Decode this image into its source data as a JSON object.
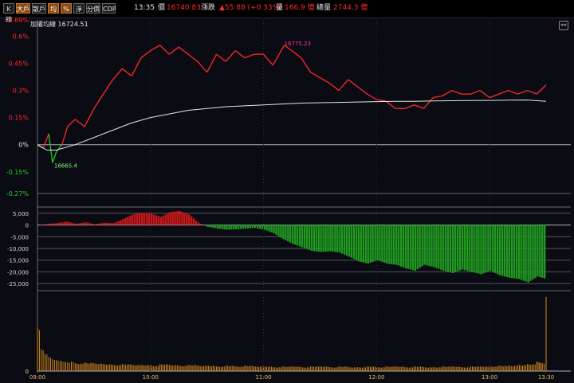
{
  "toolbar": {
    "buttons": [
      {
        "label": "K線",
        "active": false
      },
      {
        "label": "大戶",
        "active": true
      },
      {
        "label": "散戶",
        "active": false
      },
      {
        "label": "均",
        "active": true
      },
      {
        "label": "%",
        "active": true
      },
      {
        "label": "淨",
        "active": false
      },
      {
        "label": "分價",
        "active": false
      },
      {
        "label": "CDP",
        "active": false
      }
    ],
    "time": "13:35",
    "price_label": "價",
    "price": "16740.83",
    "change_label": "漲跌",
    "change": "▲55.88 (+0.33%)",
    "volume_label": "量",
    "volume": "166.9 億",
    "total_volume_label": "總量",
    "total_volume": "2744.3 億"
  },
  "sublabel": "加權均線 16724.51",
  "colors": {
    "up": "#ff2a2a",
    "down": "#22cc22",
    "avg_line": "#e6e6e6",
    "big_positive": "#cc1818",
    "big_negative": "#1f9a1f",
    "volume": "#d58a1a",
    "grid": "#6a6a72"
  },
  "icons": {
    "corner": "link-icon"
  },
  "chart_data": [
    {
      "type": "line",
      "name": "price",
      "y_ticks": [
        "0.69%",
        "0.6%",
        "0.45%",
        "0.3%",
        "0.15%",
        "0%",
        "-0.15%",
        "-0.27%"
      ],
      "y_tick_values": [
        0.69,
        0.6,
        0.45,
        0.3,
        0.15,
        0,
        -0.15,
        -0.27
      ],
      "ylim": [
        -0.27,
        0.69
      ],
      "x_ticks": [
        "09:00",
        "10:00",
        "11:00",
        "12:00",
        "13:00",
        "13:30"
      ],
      "annotations": [
        {
          "text": "16775.23",
          "x": 131,
          "y": 0.55
        },
        {
          "text": "16665.4",
          "x": 8,
          "y": -0.1
        }
      ],
      "series": [
        {
          "x": [
            0,
            3,
            6,
            8,
            10,
            13,
            16,
            20,
            25,
            30,
            35,
            40,
            45,
            50,
            55,
            60,
            65,
            70,
            75,
            80,
            85,
            90,
            95,
            100,
            105,
            110,
            115,
            120,
            125,
            131,
            135,
            140,
            145,
            150,
            155,
            160,
            165,
            170,
            175,
            180,
            185,
            190,
            195,
            200,
            205,
            210,
            215,
            220,
            225,
            230,
            235,
            240,
            245,
            250,
            255,
            260,
            265,
            270
          ],
          "values": [
            0.0,
            -0.02,
            0.06,
            -0.1,
            -0.04,
            0.0,
            0.1,
            0.14,
            0.1,
            0.2,
            0.28,
            0.36,
            0.42,
            0.38,
            0.48,
            0.52,
            0.55,
            0.5,
            0.54,
            0.5,
            0.46,
            0.4,
            0.5,
            0.46,
            0.52,
            0.48,
            0.5,
            0.5,
            0.44,
            0.55,
            0.52,
            0.48,
            0.4,
            0.37,
            0.34,
            0.3,
            0.36,
            0.32,
            0.28,
            0.25,
            0.24,
            0.2,
            0.2,
            0.22,
            0.2,
            0.26,
            0.27,
            0.3,
            0.28,
            0.28,
            0.3,
            0.26,
            0.28,
            0.3,
            0.28,
            0.3,
            0.28,
            0.33
          ]
        },
        {
          "x": [
            0,
            5,
            10,
            20,
            30,
            40,
            50,
            60,
            70,
            80,
            90,
            100,
            110,
            120,
            130,
            140,
            150,
            160,
            170,
            180,
            190,
            200,
            210,
            220,
            230,
            240,
            250,
            260,
            270
          ],
          "values": [
            0.0,
            -0.03,
            -0.03,
            0.0,
            0.04,
            0.08,
            0.12,
            0.15,
            0.17,
            0.19,
            0.2,
            0.21,
            0.215,
            0.22,
            0.225,
            0.23,
            0.232,
            0.234,
            0.236,
            0.238,
            0.24,
            0.24,
            0.242,
            0.243,
            0.244,
            0.245,
            0.246,
            0.247,
            0.24
          ]
        }
      ]
    },
    {
      "type": "area",
      "name": "big_trader_net",
      "y_ticks": [
        "5,000",
        "0",
        "-5,000",
        "-10,000",
        "-15,000",
        "-20,000",
        "-25,000"
      ],
      "y_tick_values": [
        5000,
        0,
        -5000,
        -10000,
        -15000,
        -20000,
        -25000
      ],
      "ylim": [
        -27000,
        7000
      ],
      "x": [
        0,
        5,
        10,
        15,
        20,
        25,
        30,
        35,
        40,
        45,
        50,
        55,
        60,
        65,
        70,
        75,
        80,
        85,
        90,
        95,
        100,
        105,
        110,
        115,
        120,
        125,
        130,
        135,
        140,
        145,
        150,
        155,
        160,
        165,
        170,
        175,
        180,
        185,
        190,
        195,
        200,
        205,
        210,
        215,
        220,
        225,
        230,
        235,
        240,
        245,
        250,
        255,
        260,
        265,
        270
      ],
      "values": [
        0,
        500,
        800,
        1500,
        500,
        1200,
        300,
        1000,
        800,
        2500,
        4500,
        5200,
        4800,
        3500,
        5500,
        6000,
        4500,
        1000,
        -800,
        -1500,
        -2000,
        -1800,
        -1500,
        -1200,
        -2000,
        -3500,
        -6000,
        -8000,
        -9500,
        -11000,
        -11500,
        -11200,
        -11800,
        -13500,
        -15500,
        -16500,
        -15000,
        -16500,
        -17000,
        -18500,
        -19500,
        -17000,
        -18000,
        -19500,
        -20500,
        -19000,
        -20000,
        -21000,
        -19500,
        -21500,
        -22500,
        -23000,
        -24500,
        -22000,
        -23000
      ]
    },
    {
      "type": "bar",
      "name": "volume",
      "y_ticks": [
        "0"
      ],
      "ylim": [
        0,
        100
      ],
      "x": [
        0,
        2,
        4,
        6,
        8,
        10,
        12,
        14,
        16,
        18,
        20,
        25,
        30,
        35,
        40,
        45,
        50,
        55,
        60,
        65,
        70,
        75,
        80,
        85,
        90,
        95,
        100,
        105,
        110,
        115,
        120,
        125,
        130,
        135,
        140,
        145,
        150,
        155,
        160,
        165,
        170,
        175,
        180,
        185,
        190,
        195,
        200,
        205,
        210,
        215,
        220,
        225,
        230,
        235,
        240,
        245,
        250,
        255,
        260,
        265,
        268,
        270
      ],
      "values": [
        55,
        28,
        22,
        18,
        15,
        14,
        13,
        12,
        11,
        12,
        10,
        11,
        10,
        9,
        8,
        9,
        8,
        8,
        7,
        9,
        8,
        7,
        8,
        7,
        7,
        6,
        7,
        6,
        7,
        6,
        6,
        5,
        6,
        6,
        5,
        6,
        6,
        5,
        6,
        5,
        5,
        6,
        5,
        6,
        6,
        5,
        6,
        5,
        5,
        6,
        6,
        5,
        6,
        6,
        6,
        7,
        7,
        8,
        9,
        12,
        10,
        95
      ]
    }
  ]
}
